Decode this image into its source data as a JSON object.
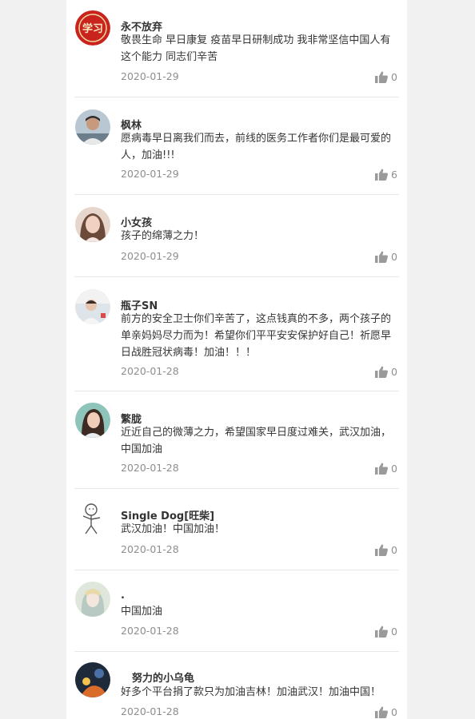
{
  "comments": [
    {
      "name": "永不放弃",
      "text": "敬畏生命 早日康复 疫苗早日研制成功 我非常坚信中国人有这个能力 同志们辛苦",
      "date": "2020-01-29",
      "likes": "0",
      "avatar_icon": "red-emblem-avatar",
      "avatar_color": "#c8231d"
    },
    {
      "name": "枫林",
      "text": "愿病毒早日离我们而去，前线的医务工作者你们是最可爱的人，加油!!!",
      "date": "2020-01-29",
      "likes": "6",
      "avatar_icon": "man-photo-avatar",
      "avatar_color": "#8fa6b8"
    },
    {
      "name": "小女孩",
      "text": "孩子的绵薄之力！",
      "date": "2020-01-29",
      "likes": "0",
      "avatar_icon": "girl-photo-avatar",
      "avatar_color": "#d9b9a8"
    },
    {
      "name": "瓶子SN",
      "text": "前方的安全卫士你们辛苦了，这点钱真的不多，两个孩子的单亲妈妈尽力而为！希望你们平平安安保护好自己！祈愿早日战胜冠状病毒！加油！！！",
      "date": "2020-01-28",
      "likes": "0",
      "avatar_icon": "child-photo-avatar",
      "avatar_color": "#c9d6dc"
    },
    {
      "name": "繁胧",
      "text": "近近自己的微薄之力，希望国家早日度过难关，武汉加油，中国加油",
      "date": "2020-01-28",
      "likes": "0",
      "avatar_icon": "woman-photo-avatar",
      "avatar_color": "#7fb8b0"
    },
    {
      "name": "Single Dog[旺柴]",
      "text": "武汉加油！中国加油！",
      "date": "2020-01-28",
      "likes": "0",
      "avatar_icon": "stick-figure-avatar",
      "avatar_color": "#ffffff"
    },
    {
      "name": ".",
      "text": "中国加油",
      "date": "2020-01-28",
      "likes": "0",
      "avatar_icon": "anime-photo-avatar",
      "avatar_color": "#cdd8c9"
    },
    {
      "name": "努力的小乌龟",
      "text": "好多个平台捐了款只为加油吉林！加油武汉！加油中国！",
      "date": "2020-01-28",
      "likes": "0",
      "avatar_icon": "dark-photo-avatar",
      "avatar_color": "#1e2a3a"
    }
  ]
}
